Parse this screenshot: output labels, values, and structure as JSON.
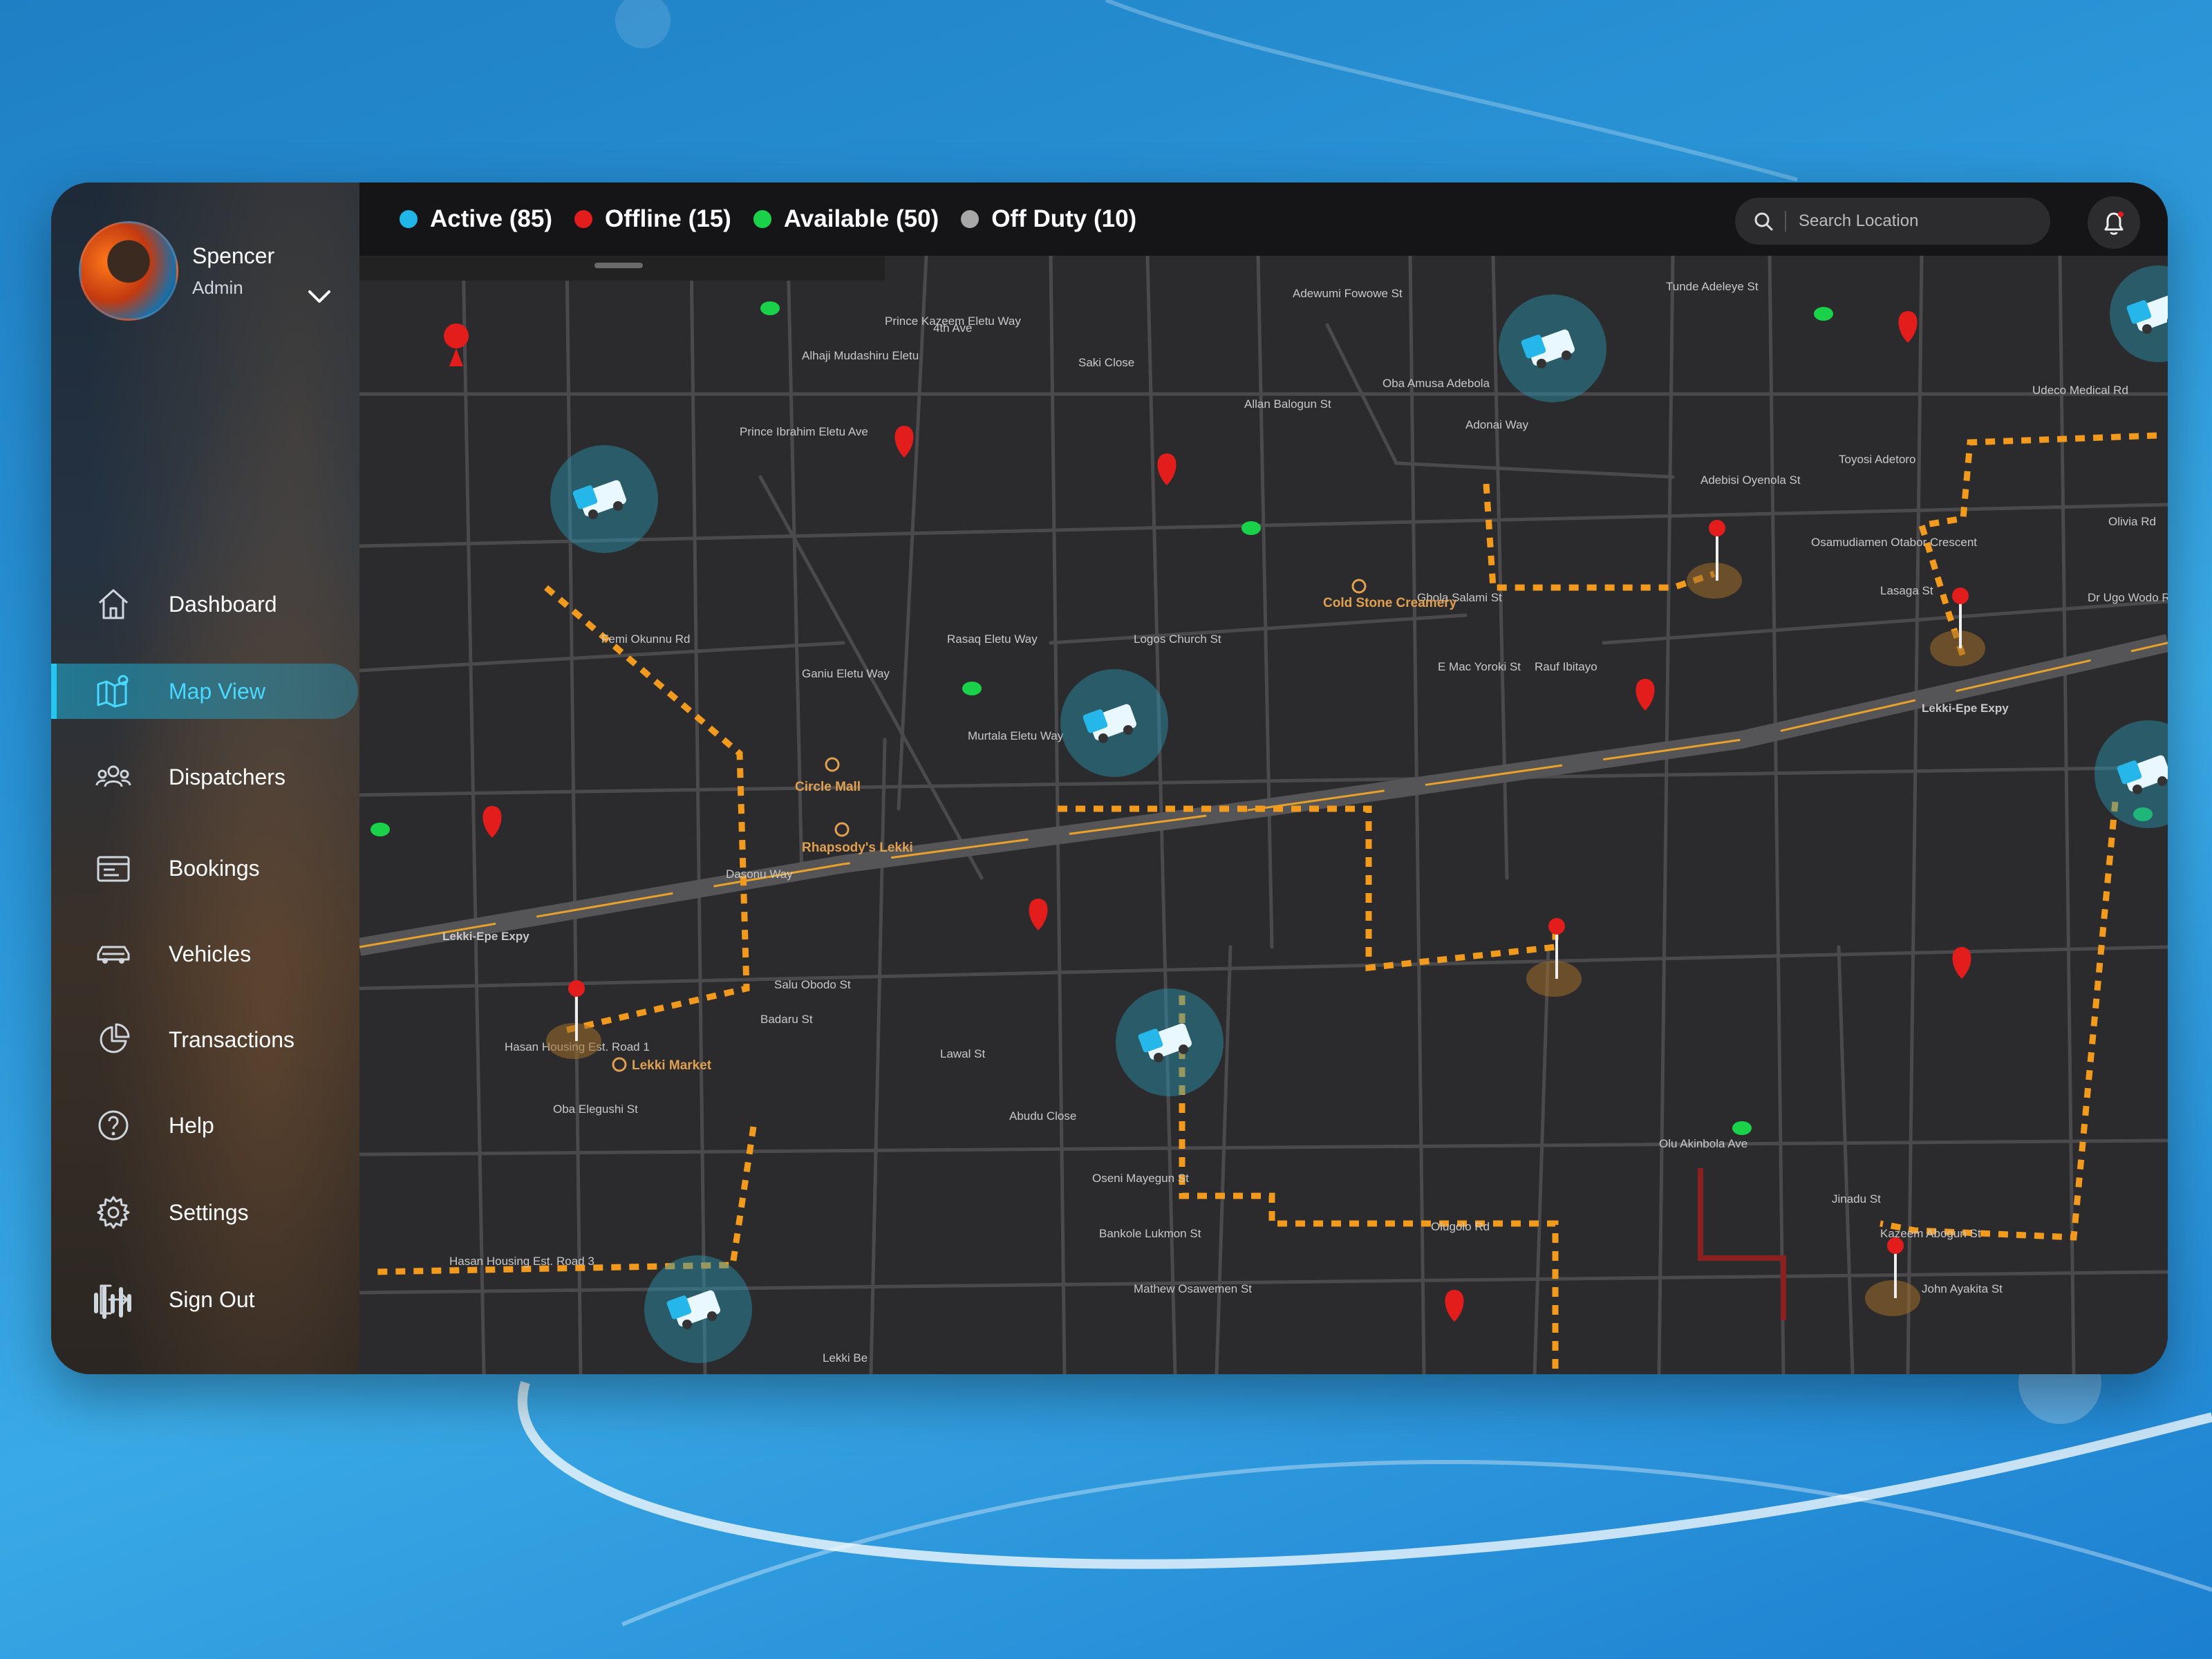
{
  "user": {
    "name": "Spencer",
    "role": "Admin"
  },
  "nav": [
    {
      "label": "Dashboard",
      "icon": "home-icon",
      "name": "nav-dashboard"
    },
    {
      "label": "Map View",
      "icon": "map-icon",
      "name": "nav-map-view",
      "active": true
    },
    {
      "label": "Dispatchers",
      "icon": "users-icon",
      "name": "nav-dispatchers"
    },
    {
      "label": "Bookings",
      "icon": "booking-card-icon",
      "name": "nav-bookings"
    },
    {
      "label": "Vehicles",
      "icon": "car-icon",
      "name": "nav-vehicles"
    },
    {
      "label": "Transactions",
      "icon": "pie-chart-icon",
      "name": "nav-transactions"
    },
    {
      "label": "Help",
      "icon": "help-icon",
      "name": "nav-help"
    },
    {
      "label": "Settings",
      "icon": "gear-icon",
      "name": "nav-settings"
    },
    {
      "label": "Sign Out",
      "icon": "sign-out-icon",
      "name": "nav-sign-out"
    }
  ],
  "legend": [
    {
      "label": "Active (85)",
      "color": "#21b6e8"
    },
    {
      "label": "Offline (15)",
      "color": "#e31c1c"
    },
    {
      "label": "Available (50)",
      "color": "#19d24a"
    },
    {
      "label": "Off Duty (10)",
      "color": "#a7a7a7"
    }
  ],
  "search": {
    "placeholder": "Search Location"
  },
  "colors": {
    "accent": "#24c6ef",
    "route": "#f29a1d",
    "map_bg": "#2b2b2d",
    "road": "#4a4a4d"
  },
  "map": {
    "streets": [
      "Tunde Adeleye St",
      "Oba Amusa Adebola",
      "Adonai Way",
      "Allan Balogun St",
      "Adewumi Fowowe St",
      "Prince Kazeem Eletu Way",
      "Alhaji Mudashiru Eletu",
      "4th Ave",
      "Prince Ibrahim Eletu Ave",
      "Saki Close",
      "Femi Okunnu Rd",
      "Ganiu Eletu Way",
      "Rasaq Eletu Way",
      "Murtala Eletu Way",
      "Logos Church St",
      "Gbola Salami St",
      "E Mac Yoroki St",
      "Adebisi Oyenola St",
      "Toyosi Adetoro",
      "Lasaga St",
      "Osamudiamen Otabor Crescent",
      "Olivia Rd",
      "Dr Ugo Wodo Rd",
      "Udeco Medical Rd",
      "Lekki-Epe Expy",
      "Lekki-Epe Expy",
      "Salu Obodo St",
      "Hasan Housing Est. Road 1",
      "Oba Elegushi St",
      "Badaru St",
      "Lawal St",
      "Abudu Close",
      "Oseni Mayegun St",
      "Bankole Lukmon St",
      "Mathew Osawemen St",
      "Hasan Housing Est. Road 3",
      "Olugolo Rd",
      "Olu Akinbola Ave",
      "Jinadu St",
      "Kazeem Abogun St",
      "John Ayakita St",
      "Dasonu Way",
      "Rauf Ibitayo",
      "Lekki Be"
    ],
    "places": [
      "Circle Mall",
      "Rhapsody's Lekki",
      "Cold Stone Creamery",
      "Lekki Market"
    ]
  }
}
